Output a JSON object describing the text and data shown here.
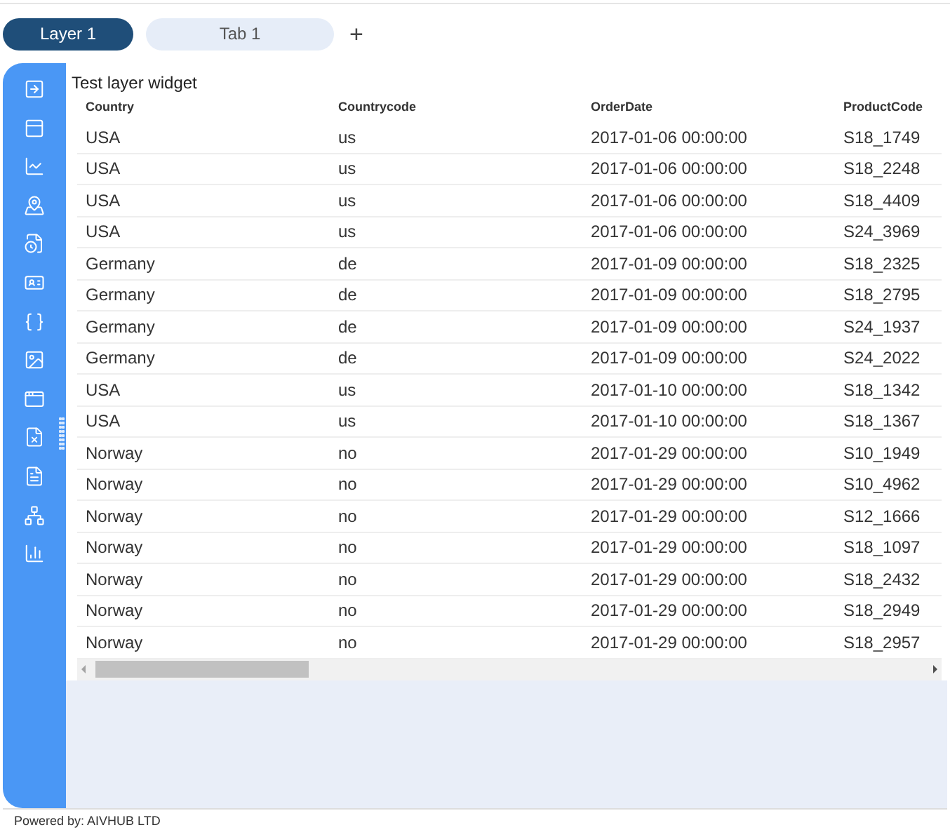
{
  "tabs": [
    {
      "label": "Layer 1",
      "selected": true
    },
    {
      "label": "Tab 1",
      "selected": false
    }
  ],
  "add_tab": "+",
  "sidebar": {
    "items": [
      {
        "kind": "arrow-box"
      },
      {
        "kind": "panel"
      },
      {
        "kind": "line-chart"
      },
      {
        "kind": "map"
      },
      {
        "kind": "file-clock"
      },
      {
        "kind": "id-card"
      },
      {
        "kind": "braces"
      },
      {
        "kind": "image"
      },
      {
        "kind": "window"
      },
      {
        "kind": "file-x"
      },
      {
        "kind": "file-w"
      },
      {
        "kind": "tree"
      },
      {
        "kind": "bar-chart"
      }
    ]
  },
  "widget": {
    "title": "Test layer widget"
  },
  "table": {
    "columns": [
      "Country",
      "Countrycode",
      "OrderDate",
      "ProductCode"
    ],
    "rows": [
      [
        "USA",
        "us",
        "2017-01-06 00:00:00",
        "S18_1749"
      ],
      [
        "USA",
        "us",
        "2017-01-06 00:00:00",
        "S18_2248"
      ],
      [
        "USA",
        "us",
        "2017-01-06 00:00:00",
        "S18_4409"
      ],
      [
        "USA",
        "us",
        "2017-01-06 00:00:00",
        "S24_3969"
      ],
      [
        "Germany",
        "de",
        "2017-01-09 00:00:00",
        "S18_2325"
      ],
      [
        "Germany",
        "de",
        "2017-01-09 00:00:00",
        "S18_2795"
      ],
      [
        "Germany",
        "de",
        "2017-01-09 00:00:00",
        "S24_1937"
      ],
      [
        "Germany",
        "de",
        "2017-01-09 00:00:00",
        "S24_2022"
      ],
      [
        "USA",
        "us",
        "2017-01-10 00:00:00",
        "S18_1342"
      ],
      [
        "USA",
        "us",
        "2017-01-10 00:00:00",
        "S18_1367"
      ],
      [
        "Norway",
        "no",
        "2017-01-29 00:00:00",
        "S10_1949"
      ],
      [
        "Norway",
        "no",
        "2017-01-29 00:00:00",
        "S10_4962"
      ],
      [
        "Norway",
        "no",
        "2017-01-29 00:00:00",
        "S12_1666"
      ],
      [
        "Norway",
        "no",
        "2017-01-29 00:00:00",
        "S18_1097"
      ],
      [
        "Norway",
        "no",
        "2017-01-29 00:00:00",
        "S18_2432"
      ],
      [
        "Norway",
        "no",
        "2017-01-29 00:00:00",
        "S18_2949"
      ],
      [
        "Norway",
        "no",
        "2017-01-29 00:00:00",
        "S18_2957"
      ]
    ]
  },
  "footer": "Powered by: AIVHUB LTD"
}
